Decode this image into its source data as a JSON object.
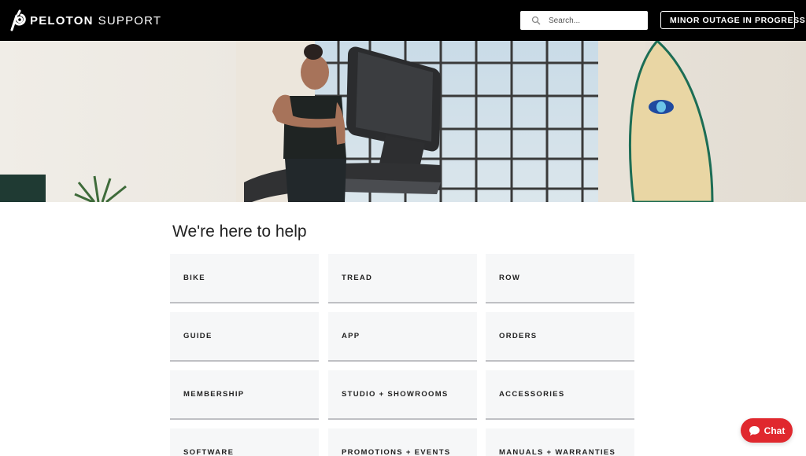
{
  "header": {
    "brand": "PELOTON",
    "brand_suffix": "SUPPORT",
    "search": {
      "placeholder": "Search...",
      "icon": "search-icon"
    },
    "status": {
      "label": "MINOR OUTAGE IN PROGRESS",
      "dot_color": "#f2d21b"
    }
  },
  "hero": {
    "image": "athlete-on-treadmill-photo"
  },
  "main": {
    "title": "We're here to help",
    "categories": [
      "BIKE",
      "TREAD",
      "ROW",
      "GUIDE",
      "APP",
      "ORDERS",
      "MEMBERSHIP",
      "STUDIO + SHOWROOMS",
      "ACCESSORIES",
      "SOFTWARE",
      "PROMOTIONS + EVENTS",
      "MANUALS + WARRANTIES"
    ]
  },
  "chat": {
    "label": "Chat",
    "icon": "chat-bubble-icon",
    "color": "#e0282e"
  }
}
